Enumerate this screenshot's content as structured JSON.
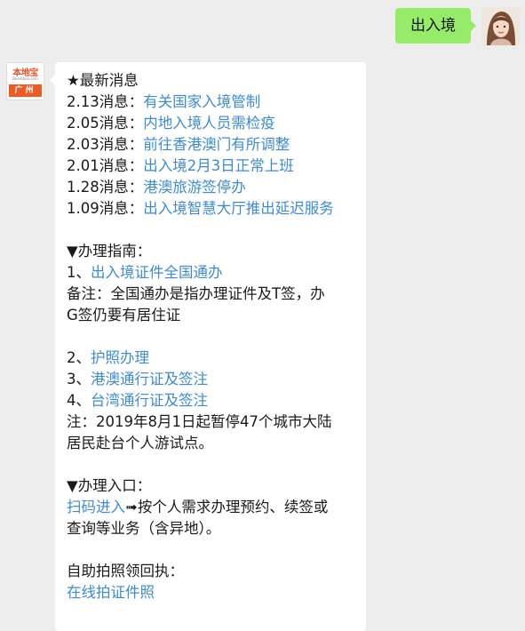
{
  "outgoing": {
    "text": "出入境"
  },
  "bot": {
    "logo_top": "本地宝",
    "logo_url": "Bendibao.com",
    "logo_city": "广州"
  },
  "news": {
    "header": "★最新消息",
    "items": [
      {
        "prefix": "2.13消息：",
        "link": "有关国家入境管制"
      },
      {
        "prefix": "2.05消息：",
        "link": "内地入境人员需检疫"
      },
      {
        "prefix": "2.03消息：",
        "link": "前往香港澳门有所调整"
      },
      {
        "prefix": "2.01消息：",
        "link": "出入境2月3日正常上班"
      },
      {
        "prefix": "1.28消息：",
        "link": "港澳旅游签停办"
      },
      {
        "prefix": "1.09消息：",
        "link": "出入境智慧大厅推出延迟服务"
      }
    ]
  },
  "guide": {
    "header": "▼办理指南：",
    "item1_prefix": "1、",
    "item1_link": "出入境证件全国通办",
    "note1_line1": "备注：全国通办是指办理证件及T签，办",
    "note1_line2": "G签仍要有居住证",
    "items": [
      {
        "prefix": "2、",
        "link": "护照办理"
      },
      {
        "prefix": "3、",
        "link": "港澳通行证及签注"
      },
      {
        "prefix": "4、",
        "link": "台湾通行证及签注"
      }
    ],
    "note2_line1": "注：2019年8月1日起暂停47个城市大陆",
    "note2_line2": "居民赴台个人游试点。"
  },
  "entry": {
    "header": "▼办理入口：",
    "link": "扫码进入",
    "text_line1": "➟按个人需求办理预约、续签或",
    "text_line2": "查询等业务（含异地）。"
  },
  "photo": {
    "header": "自助拍照领回执：",
    "link": "在线拍证件照"
  },
  "colors": {
    "outgoing_bubble": "#95ec69",
    "link": "#3d8bd6",
    "background": "#ededed"
  }
}
